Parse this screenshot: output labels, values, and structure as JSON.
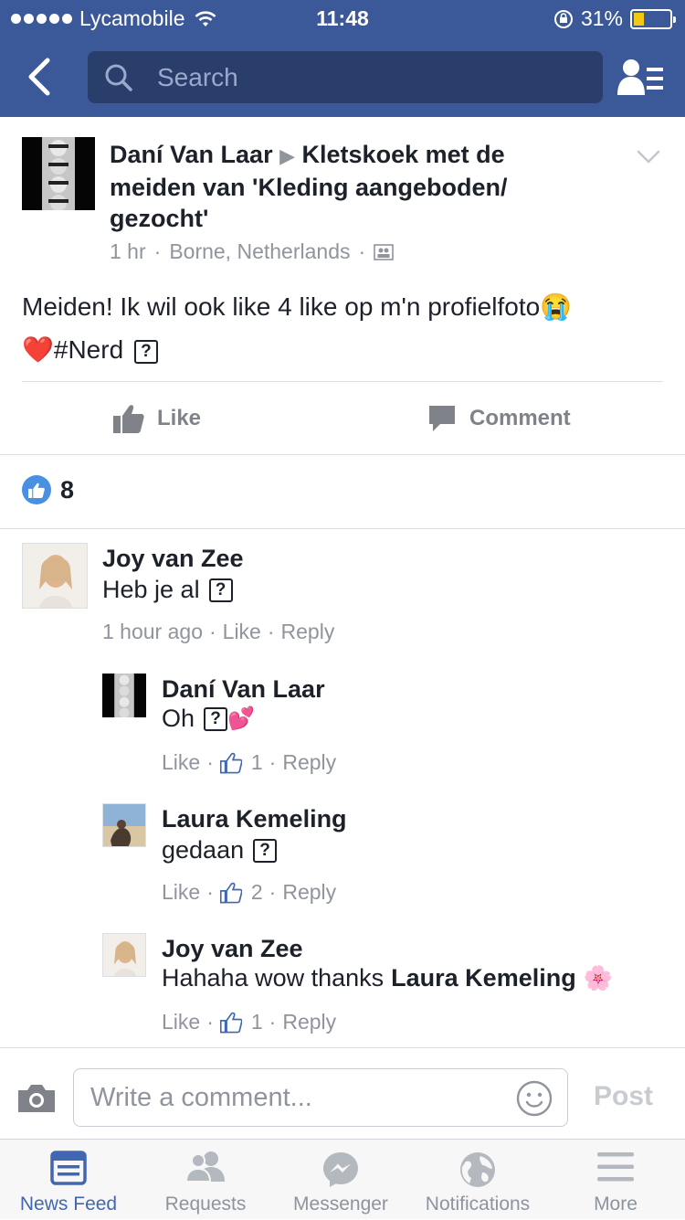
{
  "status_bar": {
    "carrier": "Lycamobile",
    "time": "11:48",
    "battery": "31%"
  },
  "search": {
    "placeholder": "Search"
  },
  "post": {
    "author": "Daní Van Laar",
    "arrow": "▶",
    "group": "Kletskoek met de meiden van 'Kleding aangeboden/ gezocht'",
    "time": "1 hr",
    "location": "Borne, Netherlands",
    "line1": "Meiden! Ik wil ook like 4 like op m'n profielfoto😭",
    "line2_heart": "❤️",
    "line2": "#Nerd",
    "unknown_glyph": "?",
    "like_label": "Like",
    "comment_label": "Comment",
    "like_count": "8"
  },
  "comments": [
    {
      "name": "Joy van Zee",
      "text": "Heb je al",
      "time": "1 hour ago",
      "like": "Like",
      "reply": "Reply"
    },
    {
      "name": "Daní Van Laar",
      "text": "Oh",
      "emoji": "💕",
      "like": "Like",
      "count": "1",
      "reply": "Reply"
    },
    {
      "name": "Laura Kemeling",
      "text": "gedaan",
      "like": "Like",
      "count": "2",
      "reply": "Reply"
    },
    {
      "name": "Joy van Zee",
      "text": "Hahaha wow thanks",
      "mention": "Laura Kemeling",
      "emoji": "🌸",
      "like": "Like",
      "count": "1",
      "reply": "Reply"
    }
  ],
  "composer": {
    "placeholder": "Write a comment...",
    "post_label": "Post"
  },
  "tabs": [
    {
      "label": "News Feed",
      "icon": "news-feed-icon",
      "active": true
    },
    {
      "label": "Requests",
      "icon": "friend-requests-icon"
    },
    {
      "label": "Messenger",
      "icon": "messenger-icon"
    },
    {
      "label": "Notifications",
      "icon": "globe-icon"
    },
    {
      "label": "More",
      "icon": "menu-icon"
    }
  ],
  "colors": {
    "brand": "#3b5998",
    "link_blue": "#4267b2",
    "muted": "#90949c"
  }
}
